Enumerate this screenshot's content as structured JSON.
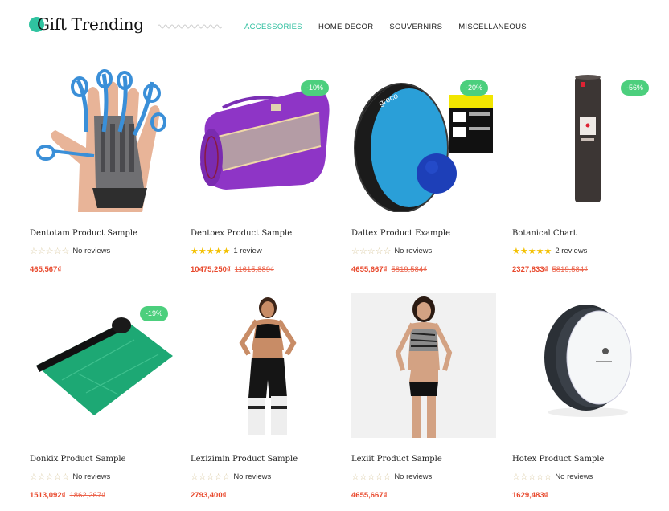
{
  "header": {
    "logo_text": "Gift Trending",
    "nav": [
      {
        "label": "ACCESSORIES",
        "active": true
      },
      {
        "label": "HOME DECOR",
        "active": false
      },
      {
        "label": "SOUVERNIRS",
        "active": false
      },
      {
        "label": "MISCELLANEOUS",
        "active": false
      }
    ]
  },
  "products": [
    {
      "title": "Dentotam Product Sample",
      "rating_stars": "☆☆☆☆☆",
      "reviews": "No reviews",
      "price": "465,567₫",
      "old_price": "",
      "badge": ""
    },
    {
      "title": "Dentoex Product Sample",
      "rating_stars": "★★★★★",
      "reviews": "1 review",
      "price": "10475,250₫",
      "old_price": "11615,889₫",
      "badge": "-10%"
    },
    {
      "title": "Daltex Product Example",
      "rating_stars": "☆☆☆☆☆",
      "reviews": "No reviews",
      "price": "4655,667₫",
      "old_price": "5819,584₫",
      "badge": "-20%"
    },
    {
      "title": "Botanical Chart",
      "rating_stars": "★★★★★",
      "reviews": "2 reviews",
      "price": "2327,833₫",
      "old_price": "5819,584₫",
      "badge": "-56%"
    },
    {
      "title": "Donkix Product Sample",
      "rating_stars": "☆☆☆☆☆",
      "reviews": "No reviews",
      "price": "1513,092₫",
      "old_price": "1862,267₫",
      "badge": "-19%"
    },
    {
      "title": "Lexizimin Product Sample",
      "rating_stars": "☆☆☆☆☆",
      "reviews": "No reviews",
      "price": "2793,400₫",
      "old_price": "",
      "badge": ""
    },
    {
      "title": "Lexiit Product Sample",
      "rating_stars": "☆☆☆☆☆",
      "reviews": "No reviews",
      "price": "4655,667₫",
      "old_price": "",
      "badge": ""
    },
    {
      "title": "Hotex Product Sample",
      "rating_stars": "☆☆☆☆☆",
      "reviews": "No reviews",
      "price": "1629,483₫",
      "old_price": "",
      "badge": ""
    }
  ],
  "icons": {
    "product_images": [
      "hand-exerciser-image",
      "duffel-bag-image",
      "yoga-wheel-image",
      "yoga-mat-roll-image",
      "green-yoga-mat-image",
      "fitness-woman-image",
      "sports-bra-woman-image",
      "white-yoga-wheel-image"
    ]
  },
  "colors": {
    "accent": "#2fbf9f",
    "badge": "#4ccf7d",
    "price": "#e8482c",
    "star": "#f3c000"
  }
}
